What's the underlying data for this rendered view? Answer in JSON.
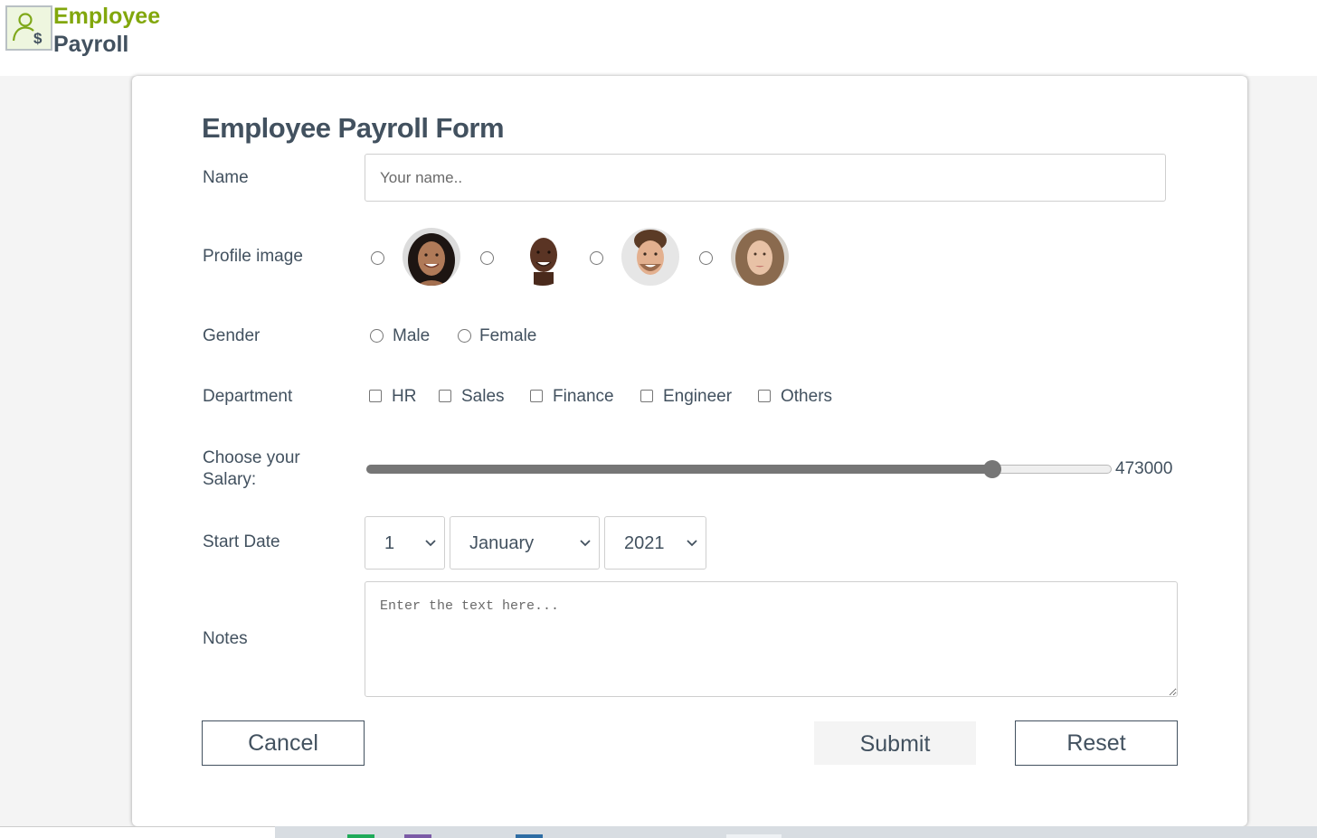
{
  "header": {
    "logo_icon": "employee-payroll-logo-icon",
    "logo_line1": "Employee",
    "logo_line2": "Payroll"
  },
  "form": {
    "title": "Employee Payroll Form",
    "name": {
      "label": "Name",
      "placeholder": "Your name..",
      "value": ""
    },
    "profile_image": {
      "label": "Profile image",
      "options": [
        "woman-dark-hair-avatar",
        "man-bald-smiling-avatar",
        "man-brown-hair-avatar",
        "woman-light-hair-avatar"
      ]
    },
    "gender": {
      "label": "Gender",
      "options": [
        "Male",
        "Female"
      ]
    },
    "department": {
      "label": "Department",
      "options": [
        "HR",
        "Sales",
        "Finance",
        "Engineer",
        "Others"
      ]
    },
    "salary": {
      "label_line1": "Choose your",
      "label_line2": "Salary:",
      "value": "473000",
      "fill_fraction": 0.84
    },
    "start_date": {
      "label": "Start Date",
      "day": "1",
      "month": "January",
      "year": "2021"
    },
    "notes": {
      "label": "Notes",
      "placeholder": "Enter the text here...",
      "value": ""
    },
    "buttons": {
      "cancel": "Cancel",
      "submit": "Submit",
      "reset": "Reset"
    }
  },
  "colors": {
    "brand_green": "#82a70c",
    "text_dark": "#42515f",
    "slider": "#767676"
  }
}
